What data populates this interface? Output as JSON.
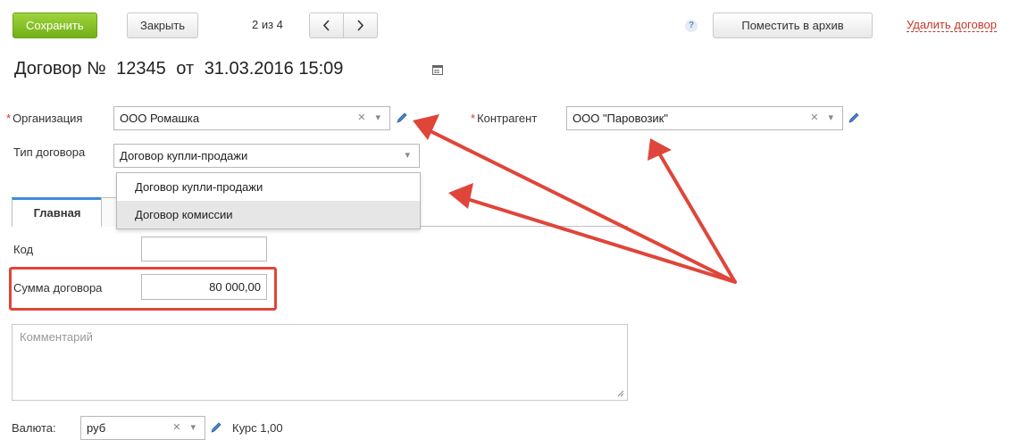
{
  "toolbar": {
    "save_label": "Сохранить",
    "close_label": "Закрыть",
    "pager_text": "2 из 4",
    "help_label": "?",
    "archive_label": "Поместить в архив",
    "delete_label": "Удалить договор"
  },
  "title": {
    "prefix": "Договор №",
    "number": "12345",
    "from": "от",
    "date": "31.03.2016 15:09"
  },
  "form": {
    "organization_label": "Организация",
    "organization_value": "ООО Ромашка",
    "counterparty_label": "Контрагент",
    "counterparty_value": "ООО \"Паровозик\"",
    "contract_type_label": "Тип договора",
    "contract_type_value": "Договор купли-продажи",
    "contract_type_options": [
      "Договор купли-продажи",
      "Договор комиссии"
    ],
    "code_label": "Код",
    "code_value": "",
    "sum_label": "Сумма договора",
    "sum_value": "80 000,00",
    "comment_placeholder": "Комментарий",
    "currency_label": "Валюта:",
    "currency_value": "руб",
    "rate_text": "Курс 1,00"
  },
  "tabs": {
    "main_label": "Главная"
  },
  "colors": {
    "accent_green": "#84c22a",
    "delete_red": "#c0392b",
    "annotation_red": "#e0453a",
    "tab_accent": "#3a8ed6"
  }
}
